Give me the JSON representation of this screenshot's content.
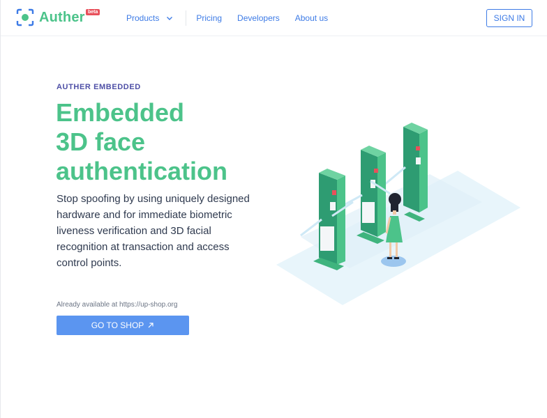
{
  "header": {
    "brand": "Auther",
    "badge": "beta",
    "nav": [
      {
        "label": "Products",
        "has_dropdown": true,
        "icon": "chevron-down-icon"
      },
      {
        "label": "Pricing"
      },
      {
        "label": "Developers"
      },
      {
        "label": "About us"
      }
    ],
    "sign_in": "SIGN IN"
  },
  "hero": {
    "eyebrow": "AUTHER EMBEDDED",
    "headline_lines": [
      "Embedded",
      "3D face",
      "authentication"
    ],
    "lede": "Stop spoofing by using uniquely designed hardware and for immediate biometric liveness verification and 3D facial recognition at transaction and access control points.",
    "availability": "Already available at https://up-shop.org",
    "cta": {
      "label": "GO TO SHOP",
      "icon": "arrow-up-right-icon"
    }
  },
  "colors": {
    "brand_green": "#4cc38a",
    "link_blue": "#3d7be6",
    "cta_blue": "#5b95f0",
    "eyebrow_purple": "#4e4fa6",
    "badge_red": "#e8505b"
  },
  "illustration": {
    "icon": "face-auth-gates-illustration"
  }
}
